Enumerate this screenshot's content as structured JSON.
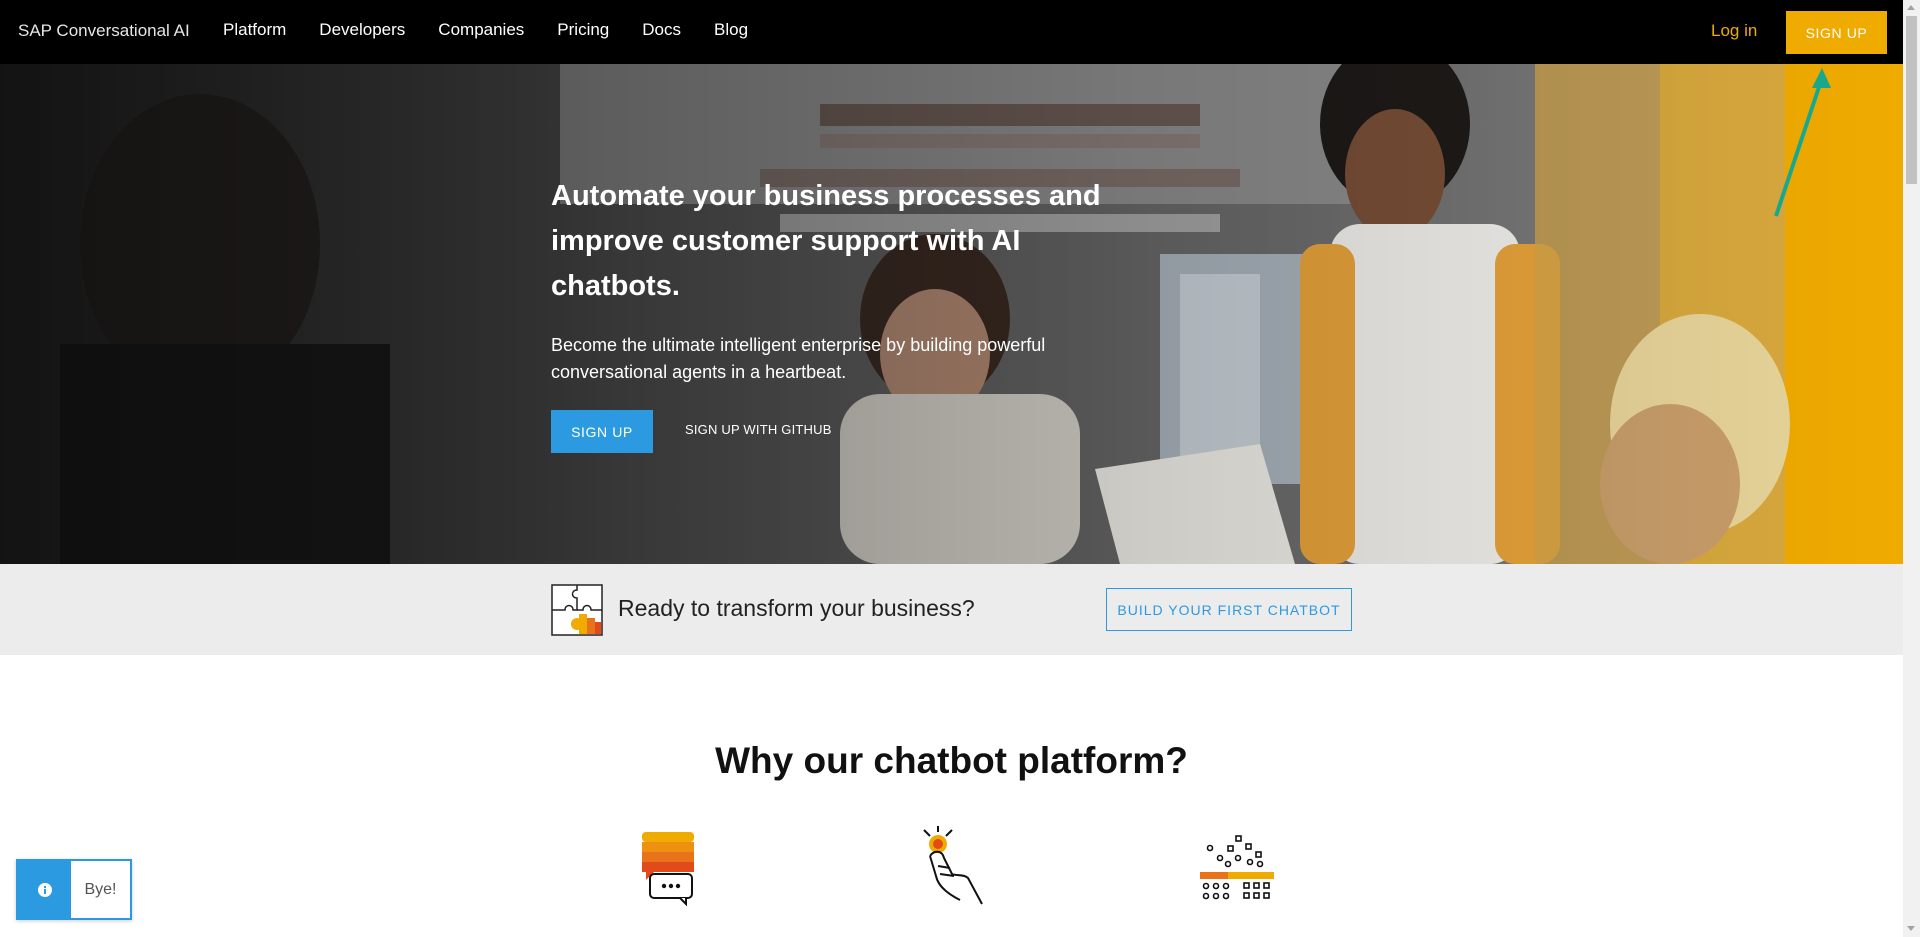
{
  "nav": {
    "brand": "SAP Conversational AI",
    "links": [
      "Platform",
      "Developers",
      "Companies",
      "Pricing",
      "Docs",
      "Blog"
    ],
    "login": "Log in",
    "signup": "SIGN UP"
  },
  "hero": {
    "title": "Automate your business processes and improve customer support with AI chatbots.",
    "subtitle": "Become the ultimate intelligent enterprise by building powerful conversational agents in a heartbeat.",
    "signup": "SIGN UP",
    "github": "SIGN UP WITH GITHUB"
  },
  "band": {
    "text": "Ready to transform your business?",
    "button": "BUILD YOUR FIRST CHATBOT"
  },
  "why": {
    "title": "Why our chatbot platform?"
  },
  "chat": {
    "message": "Bye!"
  },
  "colors": {
    "accent": "#f0ab00",
    "primary": "#2c9ae0",
    "arrow": "#1aa88d"
  }
}
